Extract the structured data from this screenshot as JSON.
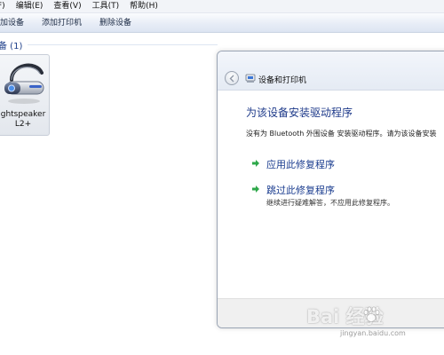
{
  "menubar": {
    "items": [
      "F)",
      "编辑(E)",
      "查看(V)",
      "工具(T)",
      "帮助(H)"
    ]
  },
  "toolbar": {
    "items": [
      "加设备",
      "添加打印机",
      "删除设备"
    ]
  },
  "group": {
    "title": "备 (1)"
  },
  "device": {
    "name_line1": "ghtspeaker",
    "name_line2": "L2+",
    "icon": "bluetooth-headset-icon"
  },
  "dialog": {
    "title": "设备和打印机",
    "main_instruction": "为该设备安装驱动程序",
    "description": "没有为 Bluetooth 外围设备 安装驱动程序。请为该设备安装",
    "options": [
      {
        "title": "应用此修复程序",
        "subtitle": ""
      },
      {
        "title": "跳过此修复程序",
        "subtitle": "继续进行疑难解答，不应用此修复程序。"
      }
    ],
    "colors": {
      "instruction": "#1e3a8a",
      "option_arrow": "#2ea84a"
    }
  },
  "watermark": {
    "logo": "Bai 经验",
    "url": "jingyan.baidu.com"
  }
}
